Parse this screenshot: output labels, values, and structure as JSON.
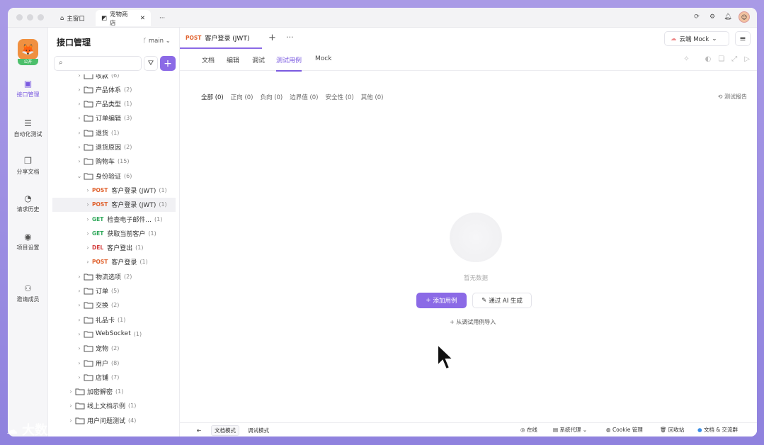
{
  "titlebar": {
    "tabs": [
      {
        "label": "主窗口"
      },
      {
        "label": "宠物商店"
      }
    ],
    "more": "···"
  },
  "rail": {
    "public_badge": "公开",
    "items": [
      {
        "label": "接口管理",
        "icon": "api-icon"
      },
      {
        "label": "自动化测试",
        "icon": "automation-icon"
      },
      {
        "label": "分享文档",
        "icon": "book-icon"
      },
      {
        "label": "请求历史",
        "icon": "history-icon"
      },
      {
        "label": "项目设置",
        "icon": "settings-icon"
      },
      {
        "label": "邀请成员",
        "icon": "invite-icon"
      }
    ]
  },
  "tree_panel": {
    "title": "接口管理",
    "branch": "main",
    "search_placeholder": "",
    "nodes": [
      {
        "type": "folder",
        "label": "收款",
        "count": "(6)"
      },
      {
        "type": "folder",
        "label": "产品体系",
        "count": "(2)"
      },
      {
        "type": "folder",
        "label": "产品类型",
        "count": "(1)"
      },
      {
        "type": "folder",
        "label": "订单编辑",
        "count": "(3)"
      },
      {
        "type": "folder",
        "label": "退货",
        "count": "(1)"
      },
      {
        "type": "folder",
        "label": "退货原因",
        "count": "(2)"
      },
      {
        "type": "folder",
        "label": "购物车",
        "count": "(15)"
      },
      {
        "type": "folder",
        "label": "身份验证",
        "count": "(6)"
      },
      {
        "type": "api",
        "method": "POST",
        "label": "客户登录 (JWT)",
        "count": "(1)"
      },
      {
        "type": "api",
        "method": "POST",
        "label": "客户登录 (JWT)",
        "count": "(1)"
      },
      {
        "type": "api",
        "method": "GET",
        "label": "检查电子邮件...",
        "count": "(1)"
      },
      {
        "type": "api",
        "method": "GET",
        "label": "获取当前客户",
        "count": "(1)"
      },
      {
        "type": "api",
        "method": "DEL",
        "label": "客户登出",
        "count": "(1)"
      },
      {
        "type": "api",
        "method": "POST",
        "label": "客户登录",
        "count": "(1)"
      },
      {
        "type": "folder",
        "label": "物流选项",
        "count": "(2)"
      },
      {
        "type": "folder",
        "label": "订单",
        "count": "(5)"
      },
      {
        "type": "folder",
        "label": "交换",
        "count": "(2)"
      },
      {
        "type": "folder",
        "label": "礼品卡",
        "count": "(1)"
      },
      {
        "type": "folder",
        "label": "WebSocket",
        "count": "(1)"
      },
      {
        "type": "folder",
        "label": "宠物",
        "count": "(2)"
      },
      {
        "type": "folder",
        "label": "用户",
        "count": "(8)"
      },
      {
        "type": "folder",
        "label": "店铺",
        "count": "(7)"
      },
      {
        "type": "folder",
        "label": "加密解密",
        "count": "(1)"
      },
      {
        "type": "folder",
        "label": "线上文档示例",
        "count": "(1)"
      },
      {
        "type": "folder",
        "label": "用户问题测试",
        "count": "(4)"
      }
    ]
  },
  "main": {
    "doc_tab": {
      "method": "POST",
      "label": "客户登录 (JWT)"
    },
    "env": "云端 Mock",
    "subtabs": [
      "文档",
      "编辑",
      "调试",
      "测试用例",
      "Mock"
    ],
    "filters": [
      "全部 (0)",
      "正向 (0)",
      "负向 (0)",
      "边界值 (0)",
      "安全性 (0)",
      "其他 (0)"
    ],
    "report": "测试报告",
    "empty_text": "暂无数据",
    "add_case": "添加用例",
    "ai_generate": "通过 AI 生成",
    "import": "从调试用例导入"
  },
  "footer": {
    "doc_mode": "文档模式",
    "debug_mode": "调试模式",
    "online": "在线",
    "proxy": "系统代理",
    "cookie": "Cookie 管理",
    "recycle": "回收站",
    "community": "文档 & 交流群"
  },
  "watermark": "大数跨境"
}
